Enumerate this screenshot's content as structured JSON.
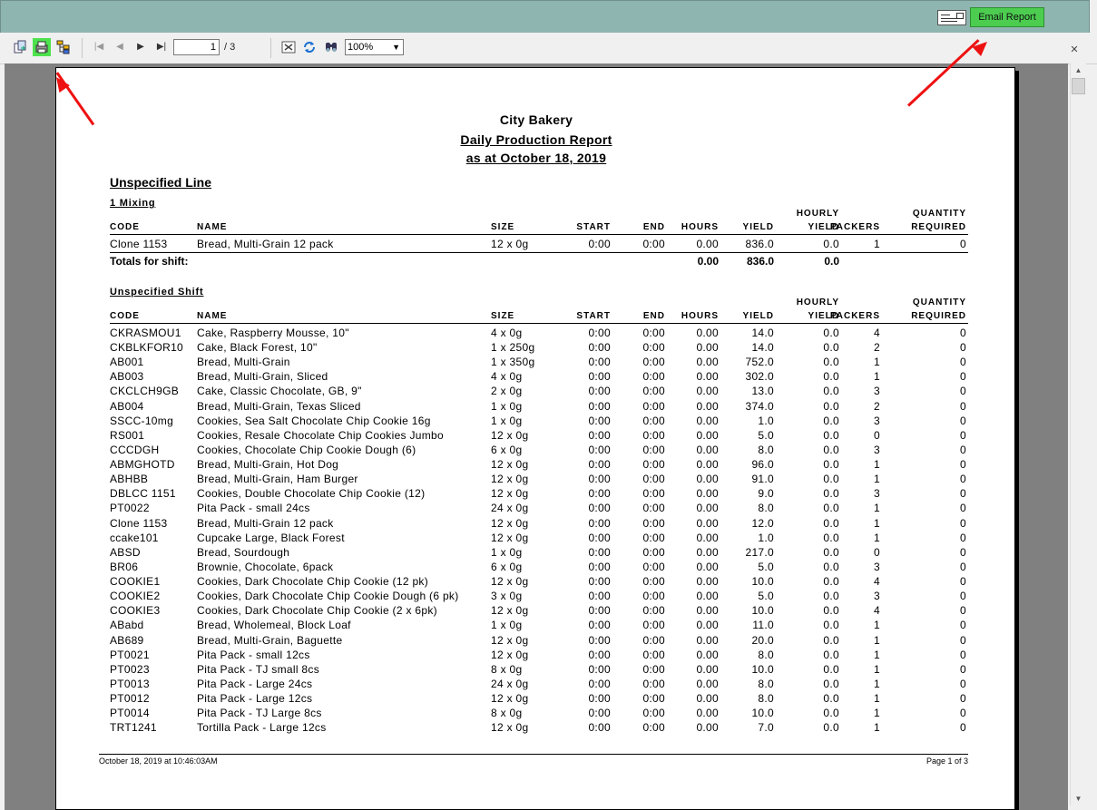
{
  "header": {
    "email_button": "Email Report",
    "envelope_icon": "envelope-icon"
  },
  "toolbar": {
    "icons": [
      "export-icon",
      "print-icon",
      "group-tree-icon",
      "first-page-icon",
      "prev-page-icon",
      "next-page-icon",
      "last-page-icon",
      "close-view-icon",
      "refresh-icon",
      "search-icon"
    ],
    "page_current": "1",
    "page_total": "/ 3",
    "zoom": "100%"
  },
  "report": {
    "company": "City Bakery",
    "title": "Daily Production Report",
    "date_line": "as at October 18, 2019",
    "line_heading": "Unspecified Line",
    "columns": {
      "code": "CODE",
      "name": "NAME",
      "size": "SIZE",
      "start": "START",
      "end": "END",
      "hours": "HOURS",
      "yield": "YIELD",
      "hourly_top": "HOURLY",
      "hourly_bottom": "YIELD",
      "packers": "PACKERS",
      "qty_top": "QUANTITY",
      "qty_bottom": "REQUIRED"
    },
    "section1": {
      "heading": "1 Mixing",
      "rows": [
        [
          "Clone 1153",
          "Bread, Multi-Grain 12 pack",
          "12 x 0g",
          "0:00",
          "0:00",
          "0.00",
          "836.0",
          "0.0",
          "1",
          "0"
        ]
      ],
      "totals_label": "Totals for shift:",
      "totals": {
        "hours": "0.00",
        "yield": "836.0",
        "hourly": "0.0"
      }
    },
    "section2": {
      "heading": "Unspecified Shift",
      "rows": [
        [
          "CKRASMOU1",
          "Cake, Raspberry Mousse, 10\"",
          "4 x 0g",
          "0:00",
          "0:00",
          "0.00",
          "14.0",
          "0.0",
          "4",
          "0"
        ],
        [
          "CKBLKFOR10",
          "Cake, Black Forest, 10\"",
          "1 x 250g",
          "0:00",
          "0:00",
          "0.00",
          "14.0",
          "0.0",
          "2",
          "0"
        ],
        [
          "AB001",
          "Bread, Multi-Grain",
          "1 x 350g",
          "0:00",
          "0:00",
          "0.00",
          "752.0",
          "0.0",
          "1",
          "0"
        ],
        [
          "AB003",
          "Bread, Multi-Grain, Sliced",
          "4 x 0g",
          "0:00",
          "0:00",
          "0.00",
          "302.0",
          "0.0",
          "1",
          "0"
        ],
        [
          "CKCLCH9GB",
          "Cake, Classic Chocolate, GB, 9\"",
          "2 x 0g",
          "0:00",
          "0:00",
          "0.00",
          "13.0",
          "0.0",
          "3",
          "0"
        ],
        [
          "AB004",
          "Bread, Multi-Grain, Texas Sliced",
          "1 x 0g",
          "0:00",
          "0:00",
          "0.00",
          "374.0",
          "0.0",
          "2",
          "0"
        ],
        [
          "SSCC-10mg",
          "Cookies, Sea Salt Chocolate Chip Cookie 16g",
          "1 x 0g",
          "0:00",
          "0:00",
          "0.00",
          "1.0",
          "0.0",
          "3",
          "0"
        ],
        [
          "RS001",
          "Cookies, Resale Chocolate Chip Cookies Jumbo",
          "12 x 0g",
          "0:00",
          "0:00",
          "0.00",
          "5.0",
          "0.0",
          "0",
          "0"
        ],
        [
          "CCCDGH",
          "Cookies, Chocolate Chip Cookie Dough (6)",
          "6 x 0g",
          "0:00",
          "0:00",
          "0.00",
          "8.0",
          "0.0",
          "3",
          "0"
        ],
        [
          "ABMGHOTD",
          "Bread, Multi-Grain, Hot Dog",
          "12 x 0g",
          "0:00",
          "0:00",
          "0.00",
          "96.0",
          "0.0",
          "1",
          "0"
        ],
        [
          "ABHBB",
          "Bread, Multi-Grain, Ham Burger",
          "12 x 0g",
          "0:00",
          "0:00",
          "0.00",
          "91.0",
          "0.0",
          "1",
          "0"
        ],
        [
          "DBLCC 1151",
          "Cookies, Double Chocolate Chip Cookie (12)",
          "12 x 0g",
          "0:00",
          "0:00",
          "0.00",
          "9.0",
          "0.0",
          "3",
          "0"
        ],
        [
          "PT0022",
          "Pita Pack - small 24cs",
          "24 x 0g",
          "0:00",
          "0:00",
          "0.00",
          "8.0",
          "0.0",
          "1",
          "0"
        ],
        [
          "Clone 1153",
          "Bread, Multi-Grain 12 pack",
          "12 x 0g",
          "0:00",
          "0:00",
          "0.00",
          "12.0",
          "0.0",
          "1",
          "0"
        ],
        [
          "ccake101",
          "Cupcake Large, Black Forest",
          "12 x 0g",
          "0:00",
          "0:00",
          "0.00",
          "1.0",
          "0.0",
          "1",
          "0"
        ],
        [
          "ABSD",
          "Bread, Sourdough",
          "1 x 0g",
          "0:00",
          "0:00",
          "0.00",
          "217.0",
          "0.0",
          "0",
          "0"
        ],
        [
          "BR06",
          "Brownie, Chocolate, 6pack",
          "6 x 0g",
          "0:00",
          "0:00",
          "0.00",
          "5.0",
          "0.0",
          "3",
          "0"
        ],
        [
          "COOKIE1",
          "Cookies, Dark Chocolate Chip Cookie (12 pk)",
          "12 x 0g",
          "0:00",
          "0:00",
          "0.00",
          "10.0",
          "0.0",
          "4",
          "0"
        ],
        [
          "COOKIE2",
          "Cookies, Dark Chocolate Chip Cookie Dough (6 pk)",
          "3 x 0g",
          "0:00",
          "0:00",
          "0.00",
          "5.0",
          "0.0",
          "3",
          "0"
        ],
        [
          "COOKIE3",
          "Cookies, Dark Chocolate Chip Cookie (2 x 6pk)",
          "12 x 0g",
          "0:00",
          "0:00",
          "0.00",
          "10.0",
          "0.0",
          "4",
          "0"
        ],
        [
          "ABabd",
          "Bread, Wholemeal, Block Loaf",
          "1 x 0g",
          "0:00",
          "0:00",
          "0.00",
          "11.0",
          "0.0",
          "1",
          "0"
        ],
        [
          "AB689",
          "Bread, Multi-Grain, Baguette",
          "12 x 0g",
          "0:00",
          "0:00",
          "0.00",
          "20.0",
          "0.0",
          "1",
          "0"
        ],
        [
          "PT0021",
          "Pita Pack - small 12cs",
          "12 x 0g",
          "0:00",
          "0:00",
          "0.00",
          "8.0",
          "0.0",
          "1",
          "0"
        ],
        [
          "PT0023",
          "Pita Pack - TJ small 8cs",
          "8 x 0g",
          "0:00",
          "0:00",
          "0.00",
          "10.0",
          "0.0",
          "1",
          "0"
        ],
        [
          "PT0013",
          "Pita Pack - Large 24cs",
          "24 x 0g",
          "0:00",
          "0:00",
          "0.00",
          "8.0",
          "0.0",
          "1",
          "0"
        ],
        [
          "PT0012",
          "Pita Pack - Large 12cs",
          "12 x 0g",
          "0:00",
          "0:00",
          "0.00",
          "8.0",
          "0.0",
          "1",
          "0"
        ],
        [
          "PT0014",
          "Pita Pack - TJ Large 8cs",
          "8 x 0g",
          "0:00",
          "0:00",
          "0.00",
          "10.0",
          "0.0",
          "1",
          "0"
        ],
        [
          "TRT1241",
          "Tortilla Pack - Large 12cs",
          "12 x 0g",
          "0:00",
          "0:00",
          "0.00",
          "7.0",
          "0.0",
          "1",
          "0"
        ]
      ]
    },
    "footer_left": "October 18, 2019 at 10:46:03AM",
    "footer_right": "Page 1 of 3"
  },
  "annotations": {
    "arrow_color": "#ee1111",
    "highlight_color": "#4ee24e"
  }
}
